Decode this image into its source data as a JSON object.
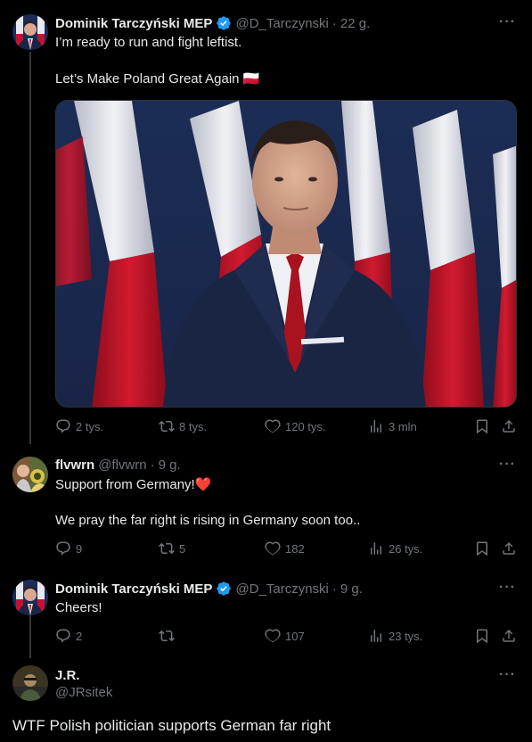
{
  "tweets": [
    {
      "author_name": "Dominik Tarczyński MEP",
      "handle": "@D_Tarczynski",
      "sep": "·",
      "time": "22 g.",
      "text_line1": "I’m ready to run and fight leftist.",
      "text_line2": "Let’s Make Poland Great Again 🇵🇱",
      "replies": "2 tys.",
      "reposts": "8 tys.",
      "likes": "120 tys.",
      "views": "3 mln"
    },
    {
      "author_name": "flvwrn",
      "handle": "@flvwrn",
      "sep": "·",
      "time": "9 g.",
      "text_line1": "Support from Germany!❤️",
      "text_line2": "We pray the far right is rising in Germany soon too..",
      "replies": "9",
      "reposts": "5",
      "likes": "182",
      "views": "26 tys."
    },
    {
      "author_name": "Dominik Tarczyński MEP",
      "handle": "@D_Tarczynski",
      "sep": "·",
      "time": "9 g.",
      "text_line1": "Cheers!",
      "replies": "2",
      "reposts": "",
      "likes": "107",
      "views": "23 tys."
    }
  ],
  "quoted": {
    "author_name": "J.R.",
    "handle": "@JRsitek",
    "text": "WTF Polish politician supports German far right"
  },
  "more_label": "···",
  "colors": {
    "background": "#000000",
    "text": "#e7e9ea",
    "muted": "#71767b",
    "verified": "#1d9bf0",
    "thread_line": "#333639"
  },
  "icons": [
    "reply-icon",
    "repost-icon",
    "like-icon",
    "views-icon",
    "bookmark-icon",
    "share-icon",
    "verified-badge-icon",
    "more-icon"
  ]
}
